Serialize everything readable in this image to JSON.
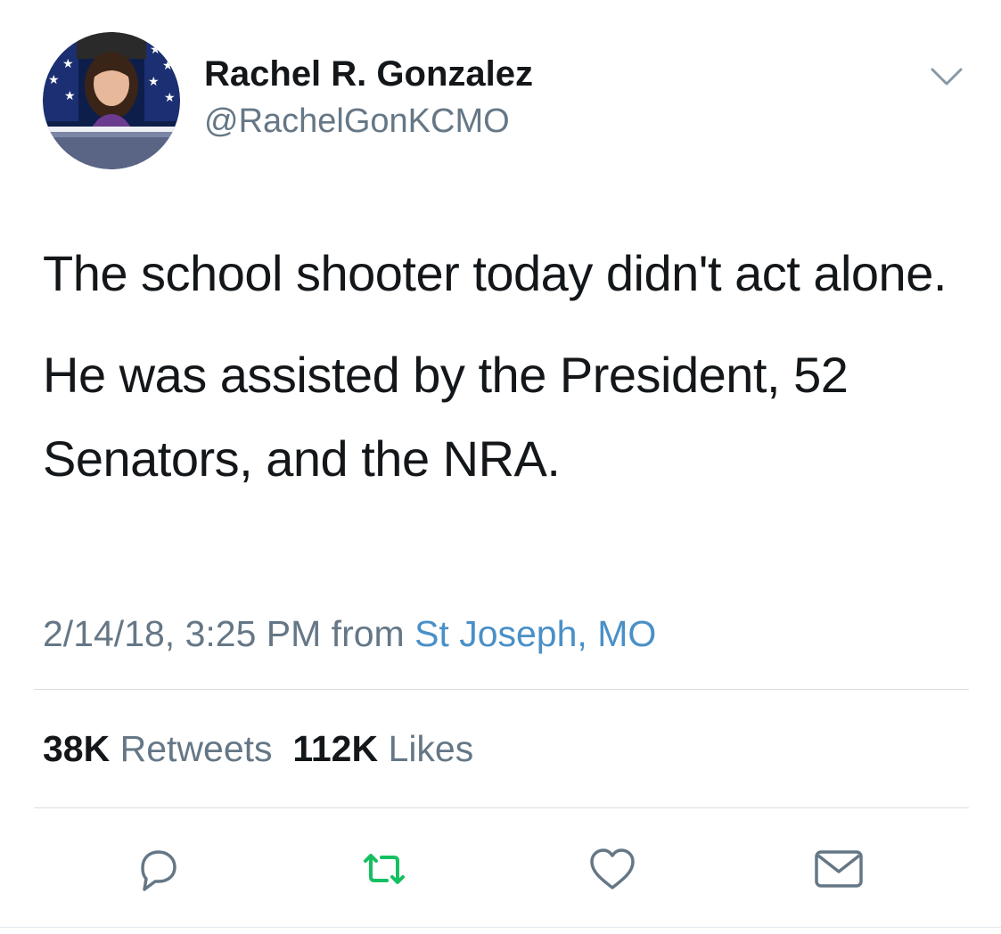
{
  "author": {
    "display_name": "Rachel R. Gonzalez",
    "handle": "@RachelGonKCMO",
    "avatar_icon": "profile-photo"
  },
  "tweet": {
    "paragraphs": [
      "The school shooter today didn't act alone.",
      "He was assisted by the President, 52 Senators, and the NRA."
    ],
    "timestamp": "2/14/18, 3:25 PM",
    "from_label": "from",
    "location": "St Joseph, MO"
  },
  "stats": {
    "retweets_count": "38K",
    "retweets_label": "Retweets",
    "likes_count": "112K",
    "likes_label": "Likes"
  },
  "actions": {
    "reply_icon": "reply-icon",
    "retweet_icon": "retweet-icon",
    "like_icon": "heart-icon",
    "dm_icon": "envelope-icon"
  },
  "colors": {
    "text_primary": "#14171a",
    "text_secondary": "#657786",
    "link": "#4a90c7",
    "retweet_green": "#17bf63",
    "icon_gray": "#657786",
    "divider": "#d9dee2"
  }
}
